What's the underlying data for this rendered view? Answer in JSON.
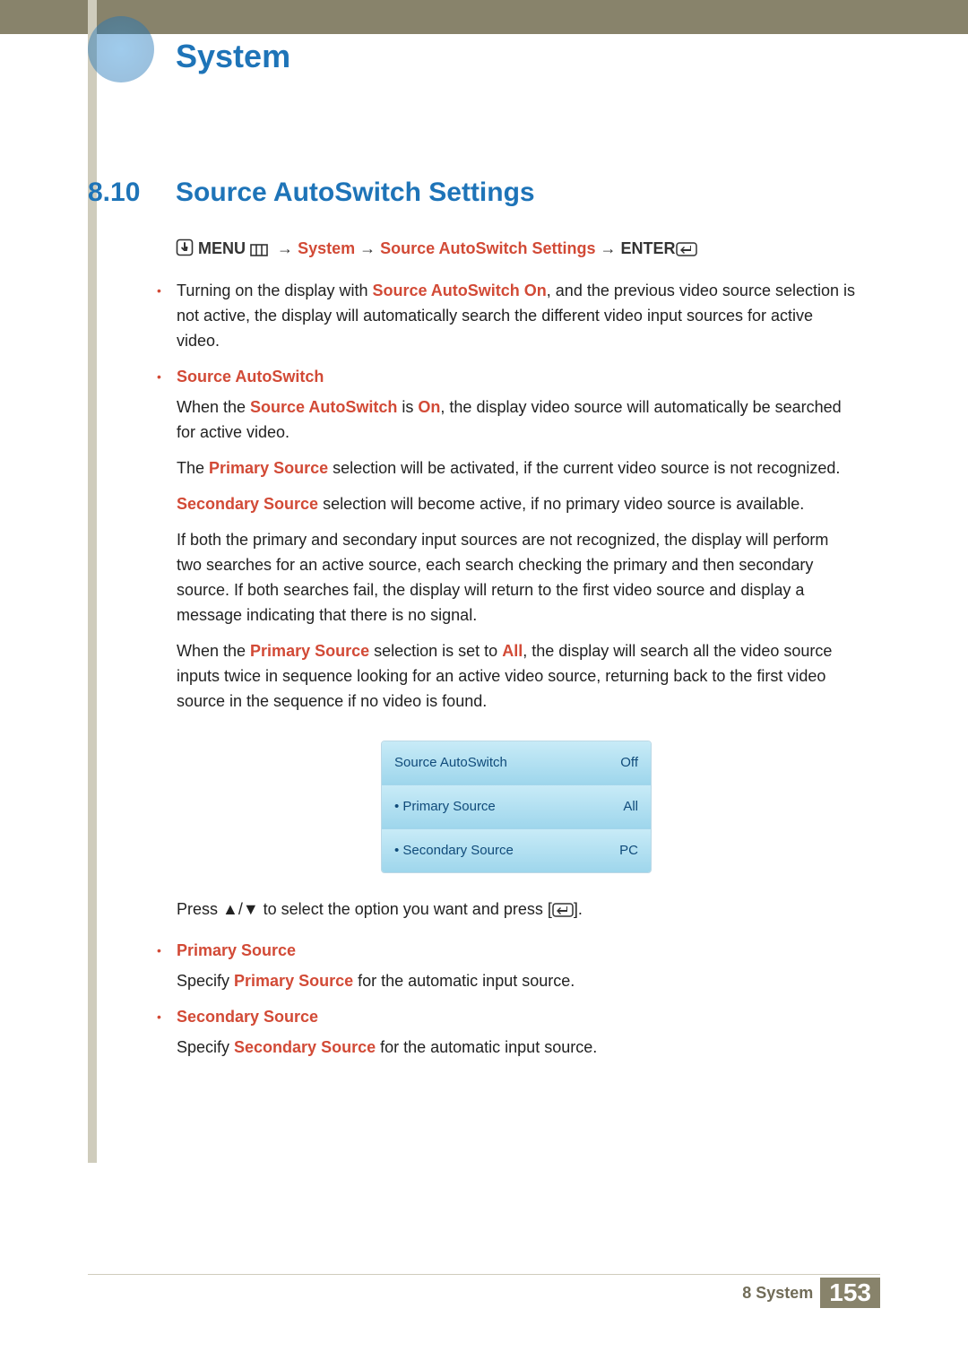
{
  "header": {
    "chapter_title": "System"
  },
  "section": {
    "number": "8.10",
    "title": "Source AutoSwitch Settings"
  },
  "breadcrumb": {
    "menu_label": "MENU",
    "arrow": "→",
    "path": [
      "System",
      "Source AutoSwitch Settings"
    ],
    "enter_label": "ENTER"
  },
  "items": [
    {
      "intro_parts": [
        "Turning on the display with ",
        "Source AutoSwitch On",
        ", and the previous video source selection is not active, the display will automatically search the different video input sources for active video."
      ]
    },
    {
      "title": "Source AutoSwitch",
      "p1_parts": [
        "When the ",
        "Source AutoSwitch",
        " is ",
        "On",
        ", the display video source will automatically be searched for active video."
      ],
      "p2_parts": [
        "The ",
        "Primary Source",
        " selection will be activated, if the current video source is not recognized."
      ],
      "p3_parts": [
        "Secondary Source",
        " selection will become active, if no primary video source is available."
      ],
      "p4": "If both the primary and secondary input sources are not recognized, the display will perform two searches for an active source, each search checking the primary and then secondary source. If both searches fail, the display will return to the first video source and display a message indicating that there is no signal.",
      "p5_parts": [
        "When the ",
        "Primary Source",
        " selection is set to ",
        "All",
        ", the display will search all the video source inputs twice in sequence looking for an active video source, returning back to the first video source in the sequence if no video is found."
      ]
    }
  ],
  "menu_box": {
    "rows": [
      {
        "label": "Source AutoSwitch",
        "value": "Off"
      },
      {
        "label": "• Primary Source",
        "value": "All"
      },
      {
        "label": "• Secondary Source",
        "value": "PC"
      }
    ]
  },
  "press_line": {
    "before": "Press ",
    "after": " to select the option you want and press [",
    "end": "]."
  },
  "primary_source": {
    "title": "Primary Source",
    "text_parts": [
      "Specify ",
      "Primary Source",
      " for the automatic input source."
    ]
  },
  "secondary_source": {
    "title": "Secondary Source",
    "text_parts": [
      "Specify ",
      "Secondary Source",
      " for the automatic input source."
    ]
  },
  "footer": {
    "label": "8 System",
    "page": "153"
  }
}
